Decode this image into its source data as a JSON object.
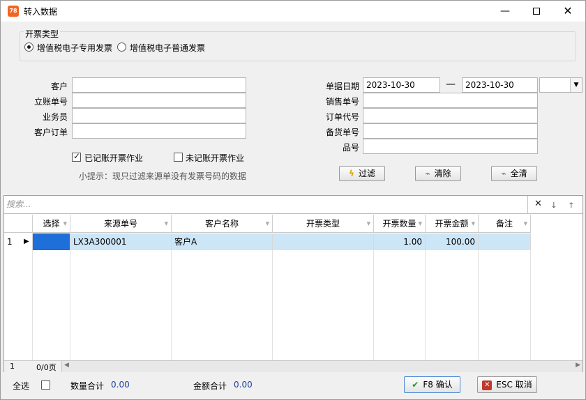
{
  "window": {
    "title": "转入数据",
    "app_icon_text": "78"
  },
  "invoice_type": {
    "group_title": "开票类型",
    "options": [
      {
        "label": "增值税电子专用发票",
        "checked": true
      },
      {
        "label": "增值税电子普通发票",
        "checked": false
      }
    ]
  },
  "filters": {
    "customer_label": "客户",
    "customer_value": "",
    "account_no_label": "立账单号",
    "account_no_value": "",
    "salesperson_label": "业务员",
    "salesperson_value": "",
    "customer_order_label": "客户订单",
    "customer_order_value": "",
    "doc_date_label": "单据日期",
    "date_from": "2023-10-30",
    "date_sep": "—",
    "date_to": "2023-10-30",
    "sales_no_label": "销售单号",
    "sales_no_value": "",
    "order_code_label": "订单代号",
    "order_code_value": "",
    "stock_no_label": "备货单号",
    "stock_no_value": "",
    "item_no_label": "品号",
    "item_no_value": "",
    "booked_label": "已记账开票作业",
    "booked_checked": true,
    "unbooked_label": "未记账开票作业",
    "unbooked_checked": false,
    "hint": "小提示：现只过滤来源单没有发票号码的数据",
    "filter_button": "过滤",
    "clear_button": "清除",
    "clear_all_button": "全清"
  },
  "grid": {
    "search_placeholder": "搜索...",
    "columns": [
      "选择",
      "来源单号",
      "客户名称",
      "开票类型",
      "开票数量",
      "开票金额",
      "备注"
    ],
    "rows": [
      {
        "index": "1",
        "select": "",
        "source_no": "LX3A300001",
        "customer_name": "客户A",
        "invoice_type": "",
        "qty": "1.00",
        "amount": "100.00",
        "remark": ""
      }
    ],
    "footer_index": "1",
    "pager": "0/0页"
  },
  "bottom": {
    "select_all_label": "全选",
    "qty_total_label": "数量合计",
    "qty_total_value": "0.00",
    "amount_total_label": "金额合计",
    "amount_total_value": "0.00",
    "confirm_button": "F8 确认",
    "cancel_button": "ESC 取消"
  }
}
